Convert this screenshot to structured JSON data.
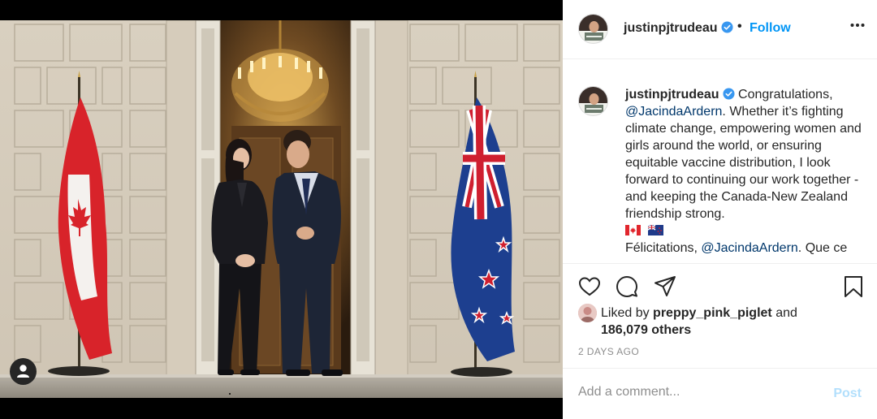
{
  "post": {
    "username": "justinpjtrudeau",
    "follow_label": "Follow",
    "separator": "•",
    "more_icon": "ellipsis-horizontal-icon",
    "verified_icon": "verified-badge-icon",
    "accent_color": "#0095f6"
  },
  "caption": {
    "username": "justinpjtrudeau",
    "part1": " Congratulations, ",
    "mention1": "@JacindaArdern",
    "part2": ". Whether it’s fighting climate change, empowering women and girls around the world, or ensuring equitable vaccine distribution, I look forward to continuing our work together - and keeping the Canada-New Zealand friendship strong.",
    "flags": [
      "canada-flag-emoji",
      "new-zealand-flag-emoji"
    ],
    "part3": "Félicitations, ",
    "mention2": "@JacindaArdern",
    "part4": ". Que ce"
  },
  "actions": {
    "icons": [
      "heart-icon",
      "comment-icon",
      "share-icon",
      "bookmark-icon"
    ]
  },
  "likes": {
    "liked_by": "Liked by ",
    "user": "preppy_pink_piglet",
    "and": " and",
    "others": "186,079 others"
  },
  "timestamp": "2 DAYS AGO",
  "comment_box": {
    "placeholder": "Add a comment...",
    "post_label": "Post"
  },
  "media": {
    "tag_icon": "user-tag-icon"
  }
}
